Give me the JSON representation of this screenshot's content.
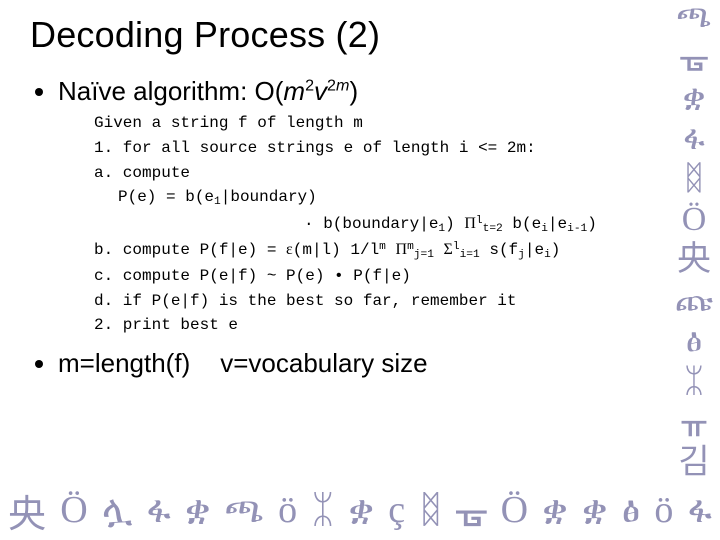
{
  "title": "Decoding Process (2)",
  "bullet1_prefix": "Naïve algorithm: O(",
  "bullet1_m": "m",
  "bullet1_exp1": "2",
  "bullet1_v": "v",
  "bullet1_exp2_num": "2",
  "bullet1_exp2_m": "m",
  "bullet1_suffix": ")",
  "algo": {
    "l0": "Given a string f of length m",
    "l1": "1. for all source strings e of length i <= 2m:",
    "l2": "a. compute",
    "l3_a": "P(e) = b(e",
    "l3_sub1": "1",
    "l3_b": "|boundary)",
    "l4_a": "· b(boundary|e",
    "l4_sub1": "1",
    "l4_b": ") ",
    "l4_prod": "Π",
    "l4_prod_sup": "l",
    "l4_prod_sub": "t=2",
    "l4_c": " b(e",
    "l4_sub_i": "i",
    "l4_d": "|e",
    "l4_sub_im1": "i-1",
    "l4_e": ")",
    "l5_a": "b. compute P(f|e) = ",
    "l5_eps": "ɛ",
    "l5_b": "(m|l) 1/l",
    "l5_exp_m": "m",
    "l5_c": " ",
    "l5_prod": "Π",
    "l5_prod_sup": "m",
    "l5_prod_sub": "j=1",
    "l5_d": " ",
    "l5_sum": "Σ",
    "l5_sum_sup": "l",
    "l5_sum_sub": "i=1",
    "l5_e": " s(f",
    "l5_sub_j": "j",
    "l5_f": "|e",
    "l5_sub_i": "i",
    "l5_g": ")",
    "l6": "c. compute P(e|f) ~ P(e) • P(f|e)",
    "l7": "d. if P(e|f) is the best so far, remember it",
    "l8": "2. print best e"
  },
  "notes_a": "m=length(f)",
  "notes_b": "v=vocabulary size",
  "deco_right": [
    "ጫ",
    "ᚗ",
    "ቋ",
    "ፋ",
    "ᛥ",
    "Ö",
    "央",
    "ጩ",
    "ፅ",
    "ᛯ",
    "ᚂ",
    "김"
  ],
  "deco_bottom": [
    "央",
    "Ö",
    "ሏ",
    "ፋ",
    "ቋ",
    "ጫ",
    "ö",
    "ᛯ",
    "ቋ",
    "ç",
    "ᛥ",
    "ᚗ",
    "Ö",
    "ቋ",
    "ቋ",
    "ፅ",
    "ö",
    "ፋ"
  ]
}
